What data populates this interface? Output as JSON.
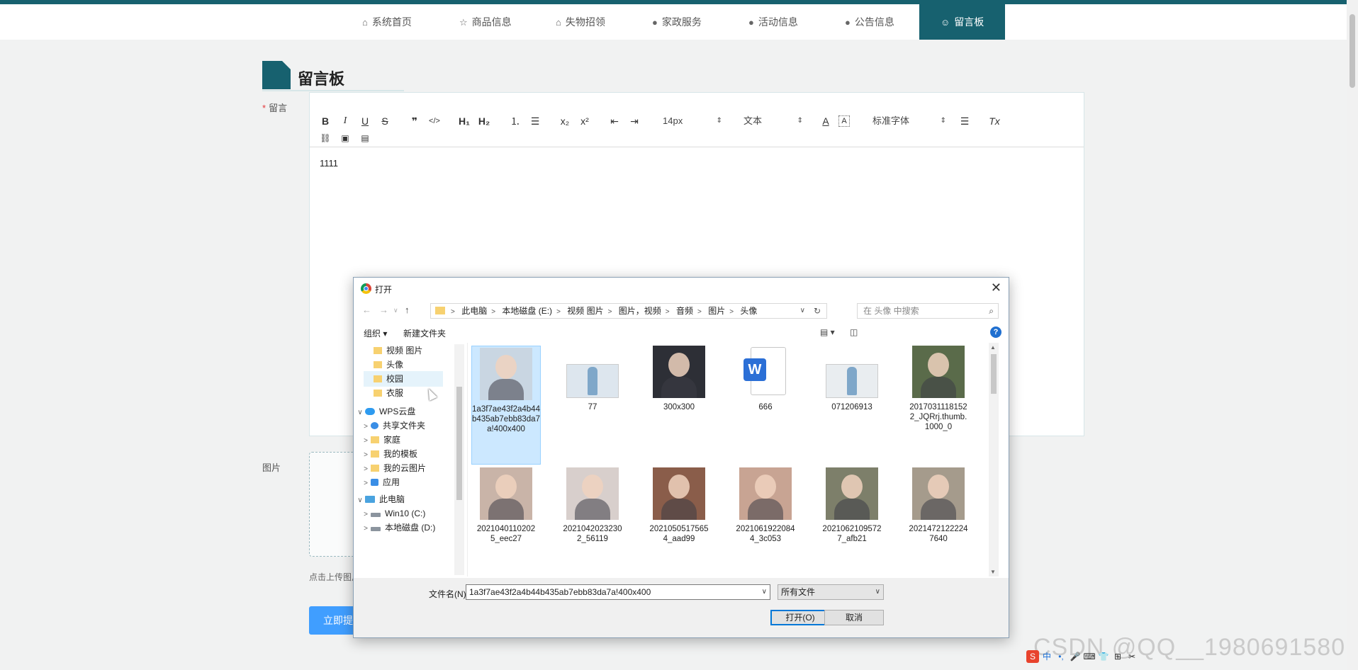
{
  "nav": {
    "items": [
      {
        "label": "系统首页",
        "icon": "home-icon",
        "glyph": "⌂"
      },
      {
        "label": "商品信息",
        "icon": "star-icon",
        "glyph": "☆"
      },
      {
        "label": "失物招领",
        "icon": "bag-icon",
        "glyph": "🛍"
      },
      {
        "label": "家政服务",
        "icon": "info-icon",
        "glyph": "❗"
      },
      {
        "label": "活动信息",
        "icon": "help-icon",
        "glyph": "❓"
      },
      {
        "label": "公告信息",
        "icon": "info-icon",
        "glyph": "❗"
      },
      {
        "label": "留言板",
        "icon": "smile-icon",
        "glyph": "☺"
      }
    ],
    "active_index": 6
  },
  "page": {
    "title": "留言板",
    "message_label": "留言",
    "required_mark": "*",
    "image_label": "图片",
    "upload_hint": "点击上传图片",
    "submit_label": "立即提交"
  },
  "editor": {
    "content": "1111",
    "font_size": "14px",
    "block_type": "文本",
    "font_family": "标准字体",
    "toolbar": {
      "bold": "B",
      "italic": "I",
      "underline": "U",
      "strike": "S",
      "quote": "❞",
      "code": "</>",
      "h1": "H₁",
      "h2": "H₂",
      "ordered_list": "⒈",
      "bullet_list": "☰",
      "subscript": "x₂",
      "superscript": "x²",
      "outdent": "⇤",
      "indent": "⇥",
      "color": "A",
      "background": "A",
      "align": "☰",
      "clean": "Tx",
      "link": "🔗",
      "image": "🖼",
      "video": "🎞"
    }
  },
  "dialog": {
    "title": "打开",
    "close": "✕",
    "address": {
      "crumbs": [
        "此电脑",
        "本地磁盘 (E:)",
        "视频 图片",
        "图片，视频",
        "音频",
        "图片",
        "头像"
      ]
    },
    "search_placeholder": "在 头像 中搜索",
    "organize": "组织 ▾",
    "new_folder": "新建文件夹",
    "help": "?",
    "tree": [
      {
        "label": "视频 图片",
        "type": "folder",
        "exp": ""
      },
      {
        "label": "头像",
        "type": "folder",
        "exp": ""
      },
      {
        "label": "校园",
        "type": "folder",
        "exp": ""
      },
      {
        "label": "衣服",
        "type": "folder",
        "exp": ""
      },
      {
        "label": "WPS云盘",
        "type": "cloud",
        "exp": "∨"
      },
      {
        "label": "共享文件夹",
        "type": "share",
        "exp": ">"
      },
      {
        "label": "家庭",
        "type": "folder",
        "exp": ">"
      },
      {
        "label": "我的模板",
        "type": "folder",
        "exp": ">"
      },
      {
        "label": "我的云图片",
        "type": "folder",
        "exp": ">"
      },
      {
        "label": "应用",
        "type": "app",
        "exp": ">"
      },
      {
        "label": "此电脑",
        "type": "pc",
        "exp": "∨"
      },
      {
        "label": "Win10 (C:)",
        "type": "drive",
        "exp": ">"
      },
      {
        "label": "本地磁盘 (D:)",
        "type": "drive",
        "exp": ">"
      }
    ],
    "files": [
      {
        "name": "1a3f7ae43f2a4b44b435ab7ebb83da7a!400x400",
        "kind": "photo",
        "color": "#c9d6e2",
        "selected": true
      },
      {
        "name": "77",
        "kind": "photo-wide",
        "color": "#dde6ee",
        "selected": false
      },
      {
        "name": "300x300",
        "kind": "photo",
        "color": "#2d2f36",
        "selected": false
      },
      {
        "name": "666",
        "kind": "word",
        "color": "#2b6fd6",
        "selected": false
      },
      {
        "name": "071206913",
        "kind": "photo-wide",
        "color": "#e9edf0",
        "selected": false
      },
      {
        "name": "20170311181522_JQRrj.thumb.1000_0",
        "kind": "photo",
        "color": "#5a6b4a",
        "selected": false
      },
      {
        "name": "20210401102025_eec27",
        "kind": "photo",
        "color": "#c9b4a8",
        "selected": false
      },
      {
        "name": "20210420232302_56119",
        "kind": "photo",
        "color": "#d8cfcc",
        "selected": false
      },
      {
        "name": "20210505175654_aad99",
        "kind": "photo",
        "color": "#8a5d4a",
        "selected": false
      },
      {
        "name": "20210619220844_3c053",
        "kind": "photo",
        "color": "#c8a493",
        "selected": false
      },
      {
        "name": "20210621095727_afb21",
        "kind": "photo",
        "color": "#7d7f6a",
        "selected": false
      },
      {
        "name": "20214721222247640",
        "kind": "photo",
        "color": "#a59b8c",
        "selected": false
      }
    ],
    "filename_label": "文件名(N):",
    "filename_value": "1a3f7ae43f2a4b44b435ab7ebb83da7a!400x400",
    "filetype": "所有文件",
    "open_label": "打开(O)",
    "cancel_label": "取消"
  },
  "watermark": "CSDN @QQ__1980691580",
  "ime": [
    "S",
    "中",
    "•,",
    "🎤",
    "⌨",
    "👕",
    "⊞",
    "✂"
  ]
}
